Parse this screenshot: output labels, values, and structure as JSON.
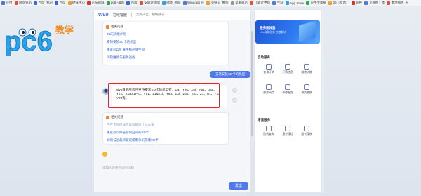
{
  "bookmarks": [
    {
      "label": "应用",
      "color": "#4a7cd9"
    },
    {
      "label": "网址导航",
      "color": "#e94b3c"
    },
    {
      "label": "百度_我的",
      "color": "#3a66d6"
    },
    {
      "label": "百度",
      "color": "#3a66d6"
    },
    {
      "label": "硬核中心",
      "color": "#f0a030"
    },
    {
      "label": "京东商城",
      "color": "#d8322e"
    },
    {
      "label": "pc6--最新",
      "color": "#2fa84f"
    },
    {
      "label": "百度",
      "color": "#3a66d6"
    },
    {
      "label": "安卓游戏网",
      "color": "#e94b3c"
    },
    {
      "label": "MSN 网站",
      "color": "#3a9de0"
    },
    {
      "label": "Windows 应",
      "color": "#4a7cd9"
    },
    {
      "label": "小铁见_推荐",
      "color": "#f0a030"
    },
    {
      "label": "苹果商店",
      "color": "#999999"
    },
    {
      "label": "【最近更新",
      "color": "#e94b3c"
    },
    {
      "label": "今日",
      "color": "#4a7cd9"
    },
    {
      "label": "App Store",
      "color": "#3a9de0"
    },
    {
      "label": "应用宝电脑",
      "color": "#2fa84f"
    },
    {
      "label": "26（原因）",
      "color": "#f0a030"
    },
    {
      "label": "影视",
      "color": "#d8322e"
    },
    {
      "label": "【看图：体",
      "color": "#4a7cd9"
    },
    {
      "label": "本地服务_在",
      "color": "#e94b3c"
    }
  ],
  "logo": {
    "text": "pc6",
    "tag": "教学"
  },
  "chat": {
    "brand": "vivo",
    "title": "在线客服",
    "subtitle": "无忧千里，畅快随心",
    "card1": {
      "title": "相关问题",
      "links": [
        "Z5的功能介绍",
        "支持安装SD卡的机型",
        "重置可以扩展手机存储空间",
        "问题维修与服务设备"
      ]
    },
    "user_message": "支持安装SD卡的机型",
    "answer": "vivo目前所售且支持安装SD卡的机型有：U3、Y9s、Z5i、Y5s、U3x、Y7s、S1&S1Pro、Y91、Z1&Z1i、Y93、Z3i、Z3x、Z5x、Z1、U1、Y3、Y70等。",
    "card2": {
      "title": "相关问题",
      "links": [
        "内存卡有时候不能读取有什么办法",
        "重置可以降低存储空间的SD卡",
        "如何与设备卸载或使用手机存储SD卡"
      ]
    },
    "input_placeholder": "请输入您要咨询的问题",
    "send_label": "发送"
  },
  "right_panel": {
    "banner_title": "服务新体验",
    "banner_sub": "vivo自助服务 快速解决",
    "section1": "自助服务",
    "services1": [
      {
        "label": "查询订单",
        "icon": "order-icon"
      },
      {
        "label": "开票信息",
        "icon": "invoice-icon"
      },
      {
        "label": "维修价格",
        "icon": "repair-price-icon"
      },
      {
        "label": "服务网点",
        "icon": "store-icon"
      },
      {
        "label": "寄修服务",
        "icon": "mail-repair-icon"
      },
      {
        "label": "预约维修",
        "icon": "appointment-icon"
      }
    ],
    "section2": "增值服务",
    "services2": [
      {
        "label": "防伪查询",
        "icon": "anti-fake-icon"
      },
      {
        "label": "意外保险",
        "icon": "insurance-icon"
      },
      {
        "label": "延长保修",
        "icon": "warranty-icon"
      }
    ]
  }
}
